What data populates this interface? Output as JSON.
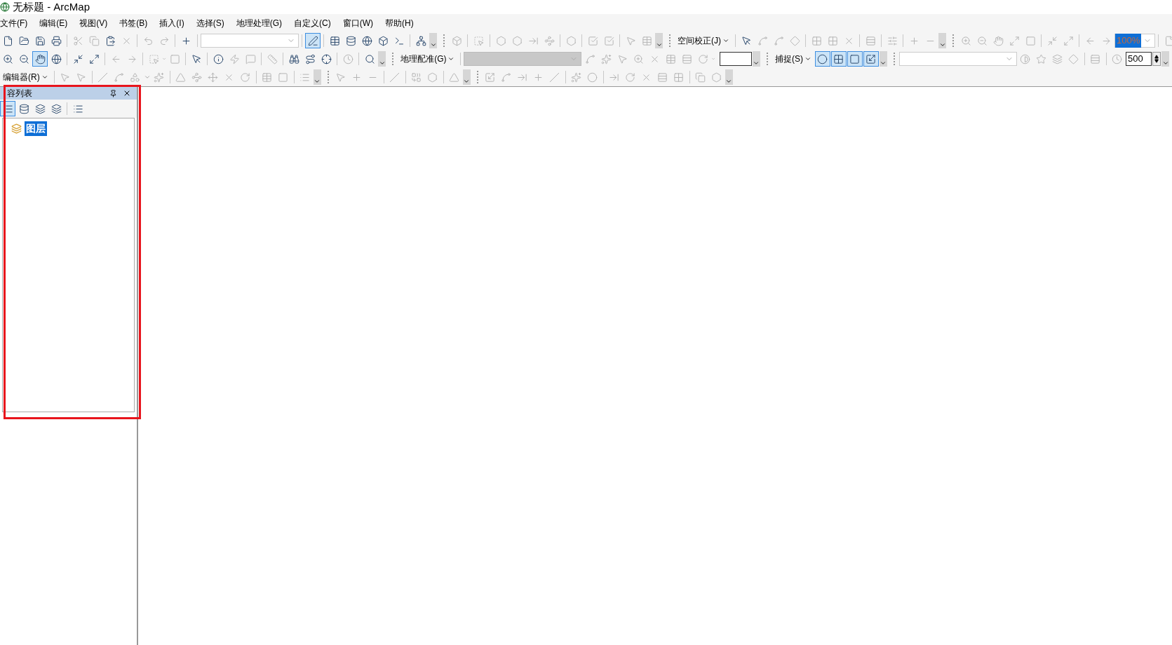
{
  "window": {
    "title": "无标题 - ArcMap"
  },
  "menu": [
    {
      "label": "文件(F)"
    },
    {
      "label": "编辑(E)"
    },
    {
      "label": "视图(V)"
    },
    {
      "label": "书签(B)"
    },
    {
      "label": "插入(I)"
    },
    {
      "label": "选择(S)"
    },
    {
      "label": "地理处理(G)"
    },
    {
      "label": "自定义(C)"
    },
    {
      "label": "窗口(W)"
    },
    {
      "label": "帮助(H)"
    }
  ],
  "toolbars": {
    "editor_toolbar_toggle": {
      "on": true
    },
    "pan_tool": {
      "selected": true
    },
    "spatial_adjustment": {
      "label": "空间校正(J)"
    },
    "georeferencing": {
      "label": "地理配准(G)"
    },
    "snapping": {
      "label": "捕捉(S)",
      "modes": [
        {
          "selected": true
        },
        {
          "selected": true
        },
        {
          "selected": true
        },
        {
          "selected": true
        }
      ]
    },
    "layout_zoom": {
      "value": "100%"
    },
    "time_step": {
      "value": "500"
    },
    "editor": {
      "label": "编辑器(R)"
    }
  },
  "toc": {
    "title": "容列表",
    "layers": [
      {
        "label": "图层",
        "selected": true
      }
    ]
  },
  "highlight_frame": {
    "color": "#e8141c"
  }
}
